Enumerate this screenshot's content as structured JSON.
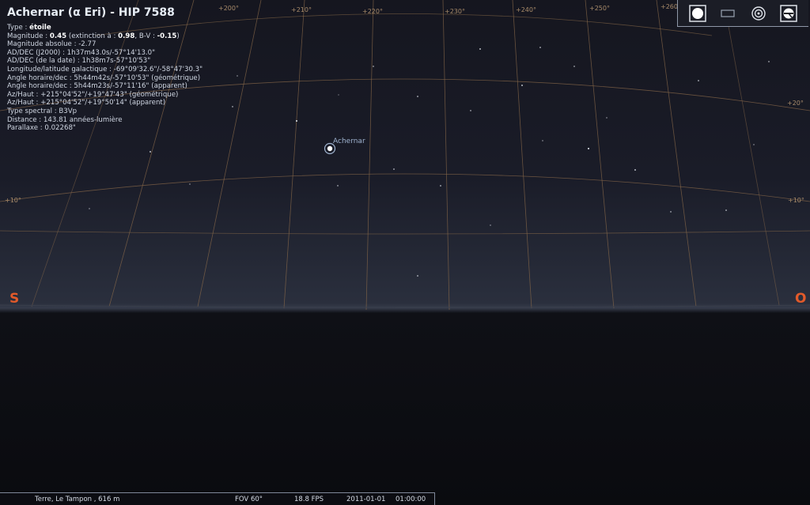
{
  "object": {
    "title": "Achernar (α Eri) - HIP 7588",
    "type_label": "Type : ",
    "type_value": "étoile",
    "magnitude_line_1": "Magnitude : ",
    "magnitude_value": "0.45",
    "magnitude_line_2": " (extinction à : ",
    "extinction_value": "0.98",
    "magnitude_line_3": ", B-V : ",
    "bv_value": "-0.15",
    "magnitude_line_4": ")",
    "absolute_magnitude": "Magnitude absolue : -2.77",
    "radec_j2000": "AD/DEC (J2000) : 1h37m43.0s/-57°14'13.0\"",
    "radec_date": "AD/DEC (de la date) : 1h38m7s-57°10'53\"",
    "galactic": "Longitude/latitude galactique : -69°09'32.6\"/-58°47'30.3\"",
    "hour_angle_geo": "Angle horaire/dec : 5h44m42s/-57°10'53\" (géométrique)",
    "hour_angle_app": "Angle horaire/dec : 5h44m23s/-57°11'16\" (apparent)",
    "azalt_geo": "Az/Haut : +215°04'52\"/+19°47'43\" (géométrique)",
    "azalt_app": "Az/Haut : +215°04'52\"/+19°50'14\" (apparent)",
    "spectral": "Type spectral : B3Vp",
    "distance": "Distance : 143.81 années-lumière",
    "parallax": "Parallaxe : 0.02268\""
  },
  "sky": {
    "star_label": "Achernar",
    "cardinal_south": "S",
    "cardinal_west": "O",
    "alt_labels": {
      "left_10": "+10°",
      "right_10": "+10°",
      "right_20": "+20°"
    },
    "az_labels": [
      "+200°",
      "+210°",
      "+220°",
      "+230°",
      "+240°",
      "+250°",
      "+260°"
    ],
    "colors": {
      "grid": "#8a6a4a",
      "cardinal": "#e25a2a"
    }
  },
  "toolbar": {
    "buttons": [
      {
        "icon": "circle-filled-icon",
        "label": ""
      },
      {
        "icon": "rectangle-icon",
        "label": ""
      },
      {
        "icon": "target-icon",
        "label": ""
      },
      {
        "icon": "telescope-icon",
        "label": ""
      }
    ]
  },
  "status": {
    "location": "Terre, Le Tampon , 616 m",
    "fov": "FOV 60°",
    "fps": "18.8 FPS",
    "date": "2011-01-01",
    "time": "01:00:00"
  }
}
